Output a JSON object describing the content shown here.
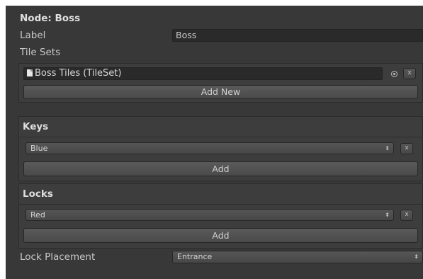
{
  "node": {
    "title": "Node: Boss",
    "label_caption": "Label",
    "label_value": "Boss",
    "tile_sets_caption": "Tile Sets"
  },
  "tile_sets": {
    "items": [
      {
        "name": "Boss Tiles (TileSet)",
        "icon": "file-icon"
      }
    ],
    "remove_label": "x",
    "add_new_label": "Add New"
  },
  "keys": {
    "header": "Keys",
    "items": [
      {
        "value": "Blue"
      }
    ],
    "arrows": "⬍",
    "remove_label": "x",
    "add_label": "Add"
  },
  "locks": {
    "header": "Locks",
    "items": [
      {
        "value": "Red"
      }
    ],
    "arrows": "⬍",
    "remove_label": "x",
    "add_label": "Add"
  },
  "lock_placement": {
    "caption": "Lock Placement",
    "value": "Entrance",
    "arrows": "⬍"
  }
}
